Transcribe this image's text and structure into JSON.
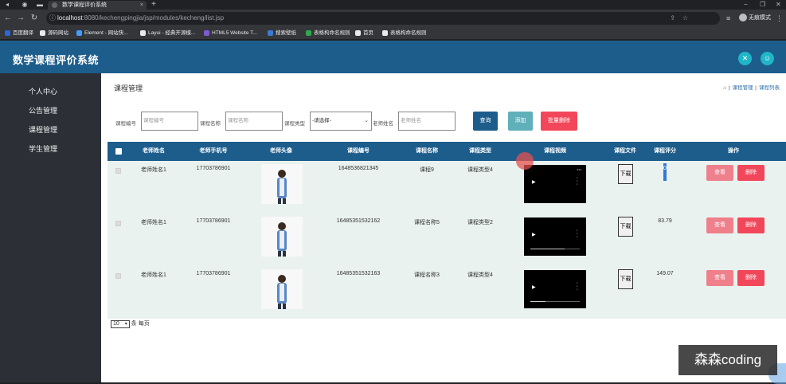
{
  "browser": {
    "tab_title": "数学课程评价系统",
    "url_host": "localhost",
    "url_path": ":8080/kechengpingjia/jsp/modules/kecheng/list.jsp",
    "profile_label": "无痕模式",
    "bookmarks": [
      {
        "label": "百度翻译",
        "color": "#2b67d8"
      },
      {
        "label": "源码网站",
        "color": "#e8eaed"
      },
      {
        "label": "Element - 网站快...",
        "color": "#409eff"
      },
      {
        "label": "Layui - 经典开源模...",
        "color": "#e8eaed"
      },
      {
        "label": "HTML5 Website T...",
        "color": "#7b5cd6"
      },
      {
        "label": "搜索壁纸",
        "color": "#3a7bd5"
      },
      {
        "label": "表格构命名规则",
        "color": "#2fa84f"
      },
      {
        "label": "首页",
        "color": "#e8eaed"
      },
      {
        "label": "表格构命名规则",
        "color": "#e8eaed"
      }
    ]
  },
  "app": {
    "title": "数学课程评价系统",
    "sidebar": [
      "个人中心",
      "公告管理",
      "课程管理",
      "学生管理"
    ],
    "page_title": "课程管理",
    "breadcrumb": [
      "课程管理",
      "课程列表"
    ]
  },
  "filters": {
    "code_label": "课程编号",
    "code_placeholder": "课程编号",
    "name_label": "课程名称",
    "name_placeholder": "课程名称",
    "type_label": "课程类型",
    "type_selected": "-请选择-",
    "teacher_label": "老师姓名",
    "teacher_placeholder": "老师姓名",
    "search_btn": "查询",
    "add_btn": "添加",
    "batch_delete_btn": "批量删除"
  },
  "table": {
    "columns": [
      "老师姓名",
      "老师手机号",
      "老师头像",
      "课程编号",
      "课程名称",
      "课程类型",
      "课程视频",
      "课程文件",
      "课程评分",
      "操作"
    ],
    "download_label": "下载",
    "view_label": "查看",
    "delete_label": "删除",
    "rows": [
      {
        "teacher": "老师姓名1",
        "phone": "17703786901",
        "code": "1648536821345",
        "name": "课程9",
        "type": "课程类型4",
        "score": "0",
        "video_progress": 0
      },
      {
        "teacher": "老师姓名1",
        "phone": "17703786901",
        "code": "16485351532162",
        "name": "课程名称5",
        "type": "课程类型2",
        "score": "83.79",
        "video_progress": 0.7
      },
      {
        "teacher": "老师姓名1",
        "phone": "17703786901",
        "code": "16485351532163",
        "name": "课程名称3",
        "type": "课程类型4",
        "score": "149.07",
        "video_progress": 0.3
      }
    ]
  },
  "pager": {
    "page_size": "10",
    "suffix": "条 每页"
  },
  "watermark": "森森coding",
  "colors": {
    "header": "#1d5d8c",
    "sidebar": "#2c3036",
    "search_btn": "#1d5d8c",
    "add_btn": "#5fb0b8",
    "danger": "#f2475a",
    "view": "#ef7f8b"
  }
}
